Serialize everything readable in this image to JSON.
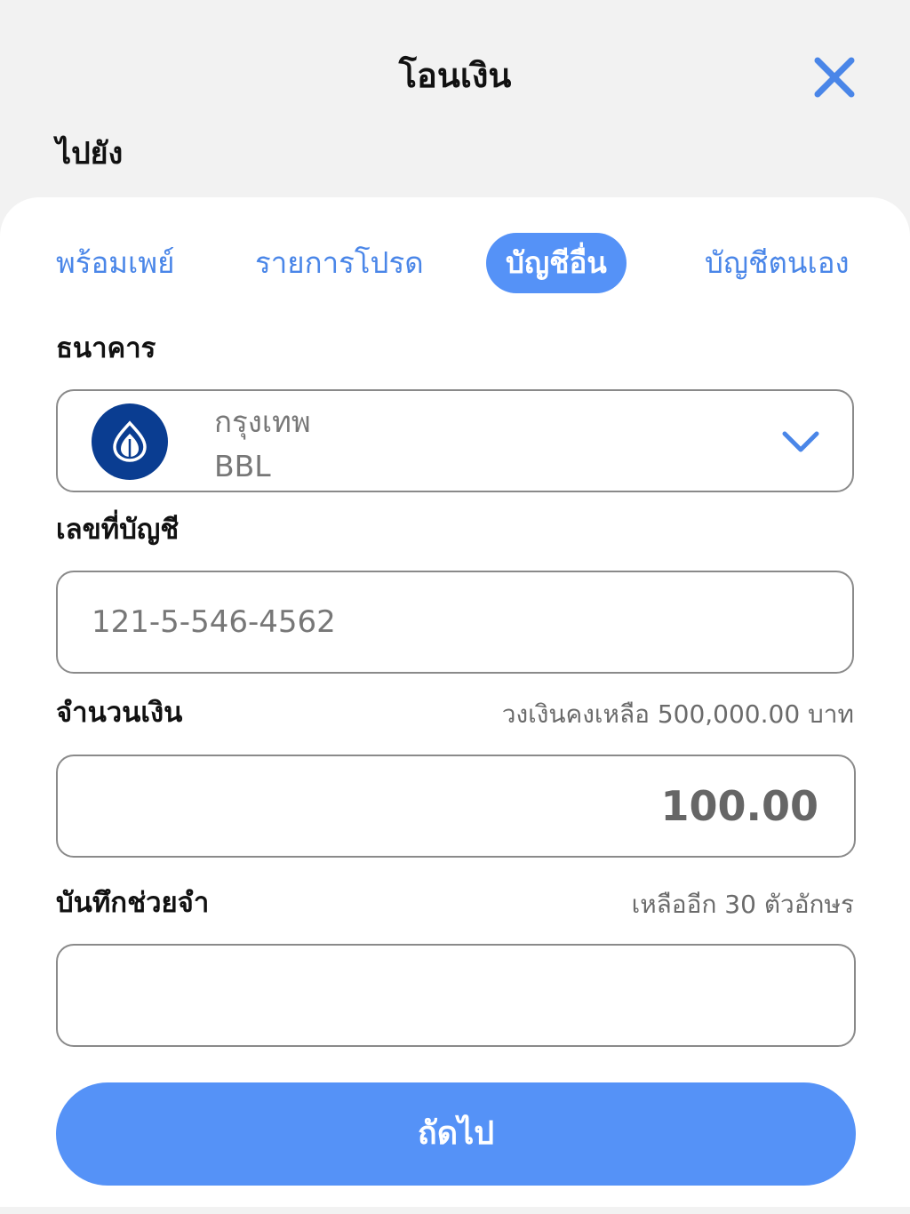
{
  "header": {
    "title": "โอนเงิน",
    "close_icon": "close-icon"
  },
  "destination_label": "ไปยัง",
  "tabs": [
    {
      "label": "พร้อมเพย์",
      "active": false
    },
    {
      "label": "รายการโปรด",
      "active": false
    },
    {
      "label": "บัญชีอื่น",
      "active": true
    },
    {
      "label": "บัญชีตนเอง",
      "active": false
    }
  ],
  "bank": {
    "label": "ธนาคาร",
    "selected_name": "กรุงเทพ",
    "selected_code": "BBL",
    "logo_icon": "bank-lotus-logo",
    "logo_color": "#0a3d91"
  },
  "account": {
    "label": "เลขที่บัญชี",
    "value": "121-5-546-4562"
  },
  "amount": {
    "label": "จำนวนเงิน",
    "limit_hint": "วงเงินคงเหลือ 500,000.00 บาท",
    "value": "100.00"
  },
  "memo": {
    "label": "บันทึกช่วยจำ",
    "remaining_hint": "เหลืออีก 30 ตัวอักษร",
    "value": ""
  },
  "next_button": {
    "label": "ถัดไป"
  },
  "colors": {
    "accent": "#5592f7",
    "accent_text": "#4a86e8",
    "background": "#f2f2f2"
  }
}
